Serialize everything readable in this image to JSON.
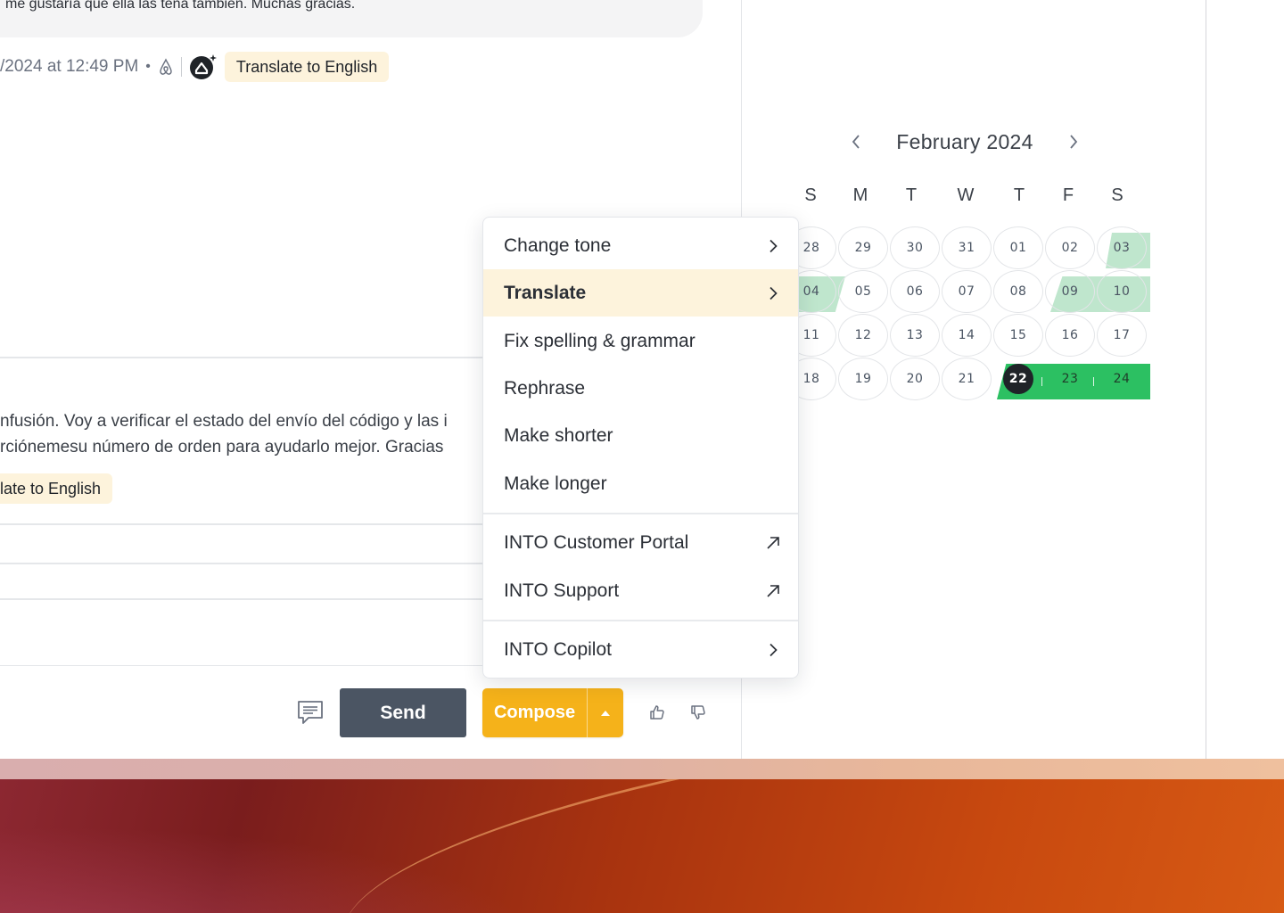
{
  "conversation": {
    "message_text": "me gustaría que ella las tena también. Muchas gracias.",
    "message_time": "/2024 at 12:49 PM",
    "meta_separator": "•",
    "translate_chip_label": "Translate to English",
    "reply_line1": "nfusión. Voy a verificar el estado del envío del código y las i",
    "reply_line2": "rciónemesu número de orden para ayudarlo mejor. Gracias",
    "reply_translate_chip_label": "late to English"
  },
  "composer": {
    "send_label": "Send",
    "compose_label": "Compose"
  },
  "calendar": {
    "month_title": "February 2024",
    "weekdays": [
      "S",
      "M",
      "T",
      "W",
      "T",
      "F",
      "S"
    ],
    "weeks": [
      [
        "28",
        "29",
        "30",
        "31",
        "01",
        "02",
        "03"
      ],
      [
        "04",
        "05",
        "06",
        "07",
        "08",
        "09",
        "10"
      ],
      [
        "11",
        "12",
        "13",
        "14",
        "15",
        "16",
        "17"
      ],
      [
        "18",
        "19",
        "20",
        "21",
        "22",
        "23",
        "24"
      ]
    ],
    "today": "22",
    "colors": {
      "light_booking": "#bfe6cd",
      "dark_booking": "#2cc062",
      "today_bg": "#1f2328"
    }
  },
  "menu": {
    "items": [
      {
        "label": "Change tone",
        "icon": "chevron-right-icon"
      },
      {
        "label": "Translate",
        "icon": "chevron-right-icon",
        "active": true
      },
      {
        "label": "Fix spelling & grammar"
      },
      {
        "label": "Rephrase"
      },
      {
        "label": "Make shorter"
      },
      {
        "label": "Make longer"
      },
      {
        "label": "INTO Customer Portal",
        "icon": "external-link-icon"
      },
      {
        "label": "INTO Support",
        "icon": "external-link-icon"
      },
      {
        "label": "INTO Copilot",
        "icon": "chevron-right-icon"
      }
    ]
  },
  "colors": {
    "accent_compose": "#f5b21a",
    "send_button": "#4b5563",
    "translate_chip": "#fdf3dc"
  }
}
